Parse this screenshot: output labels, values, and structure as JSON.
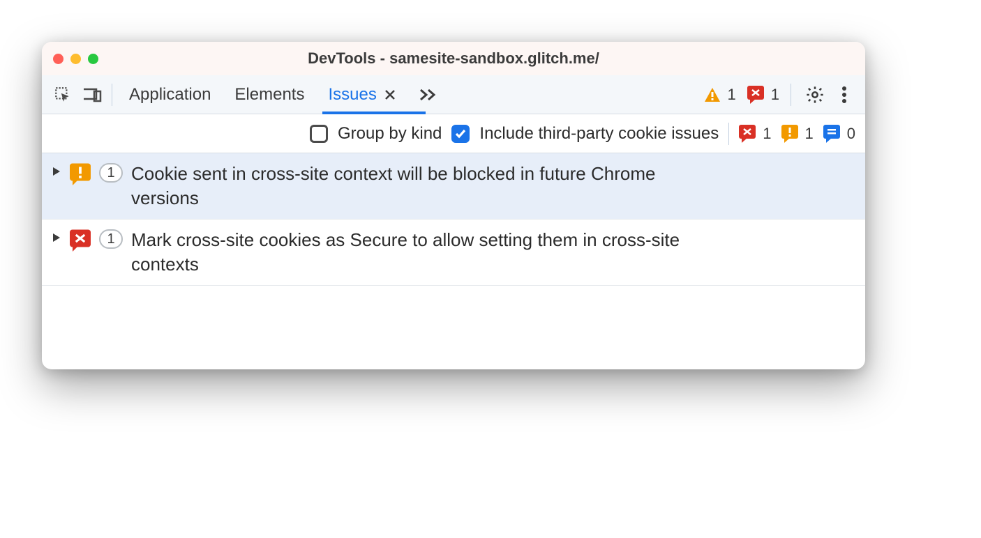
{
  "window": {
    "title": "DevTools - samesite-sandbox.glitch.me/"
  },
  "tabs": {
    "application": "Application",
    "elements": "Elements",
    "issues": "Issues"
  },
  "header_counters": {
    "warnings": "1",
    "errors": "1"
  },
  "filters": {
    "group_by_kind": "Group by kind",
    "include_third_party": "Include third-party cookie issues"
  },
  "filter_counters": {
    "errors": "1",
    "warnings": "1",
    "info": "0"
  },
  "issues": [
    {
      "count": "1",
      "title": "Cookie sent in cross-site context will be blocked in future Chrome versions",
      "severity": "warning"
    },
    {
      "count": "1",
      "title": "Mark cross-site cookies as Secure to allow setting them in cross-site contexts",
      "severity": "error"
    }
  ]
}
